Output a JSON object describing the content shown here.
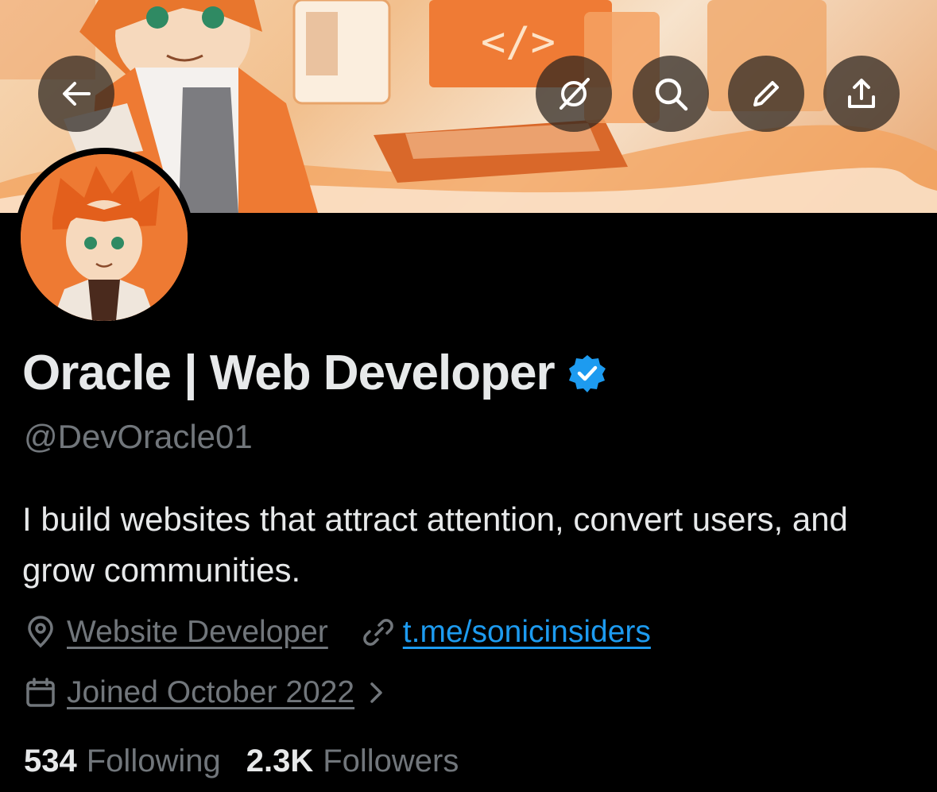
{
  "header": {
    "back_icon": "arrow-left-icon",
    "actions": [
      {
        "icon": "grok-slash-icon"
      },
      {
        "icon": "search-icon"
      },
      {
        "icon": "edit-pencil-icon"
      },
      {
        "icon": "share-upload-icon"
      }
    ]
  },
  "profile": {
    "display_name": "Oracle | Web Developer",
    "verified_icon": "verified-badge-icon",
    "handle": "@DevOracle01",
    "bio": "I build websites that attract attention, convert users, and grow communities.",
    "location": "Website Developer",
    "website": "t.me/sonicinsiders",
    "joined": "Joined October 2022"
  },
  "stats": {
    "following_count": "534",
    "following_label": "Following",
    "followers_count": "2.3K",
    "followers_label": "Followers"
  },
  "colors": {
    "background": "#000000",
    "primary_text": "#e7e9ea",
    "secondary_text": "#71767b",
    "link": "#1d9bf0",
    "verified": "#1d9bf0",
    "banner_accent": "#ee7a33"
  }
}
